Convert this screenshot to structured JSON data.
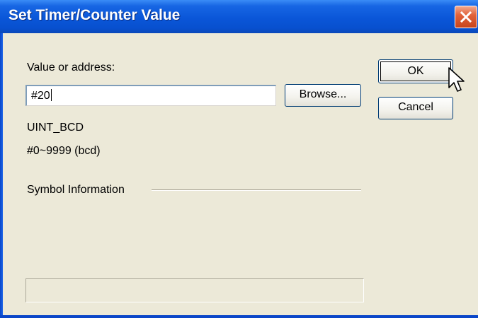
{
  "window": {
    "title": "Set Timer/Counter Value"
  },
  "form": {
    "value_label": "Value or address:",
    "value_input": "#20",
    "data_type": "UINT_BCD",
    "range": "#0~9999 (bcd)",
    "symbol_info_label": "Symbol Information",
    "status_text": ""
  },
  "buttons": {
    "browse": "Browse...",
    "ok": "OK",
    "cancel": "Cancel"
  },
  "icons": {
    "close": "close-icon",
    "cursor": "arrow-cursor-icon"
  },
  "colors": {
    "titlebar": "#0a56d8",
    "close_button": "#e2633b",
    "dialog_background": "#ece9d8"
  }
}
